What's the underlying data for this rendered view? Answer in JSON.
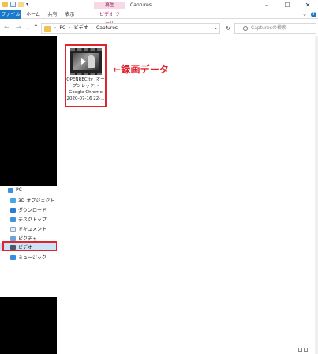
{
  "window": {
    "title": "Captures",
    "context_tab_label": "再生",
    "buttons": {
      "minimize": "–",
      "maximize": "☐",
      "close": "✕"
    }
  },
  "ribbon": {
    "tabs": [
      "ファイル",
      "ホーム",
      "共有",
      "表示",
      "ビデオ ツール"
    ],
    "help_label": "?"
  },
  "nav": {
    "breadcrumb": [
      "PC",
      "ビデオ",
      "Captures"
    ],
    "search_placeholder": "Capturesの検索"
  },
  "sidebar": {
    "items": [
      {
        "label": "PC",
        "icon": "pc-icon"
      },
      {
        "label": "3D オブジェクト",
        "icon": "3d-objects-icon"
      },
      {
        "label": "ダウンロード",
        "icon": "download-icon"
      },
      {
        "label": "デスクトップ",
        "icon": "desktop-icon"
      },
      {
        "label": "ドキュメント",
        "icon": "document-icon"
      },
      {
        "label": "ピクチャ",
        "icon": "pictures-icon"
      },
      {
        "label": "ビデオ",
        "icon": "videos-icon",
        "selected": true
      },
      {
        "label": "ミュージック",
        "icon": "music-icon"
      }
    ]
  },
  "file": {
    "name_lines": [
      "OPENREC.tv (オー",
      "プンレック) -",
      "Google Chrome",
      "2020-07-16 22-..."
    ]
  },
  "annotation": "←録画データ",
  "colors": {
    "accent": "#1979ca",
    "highlight": "#e0242e",
    "context": "#9a2b64"
  }
}
